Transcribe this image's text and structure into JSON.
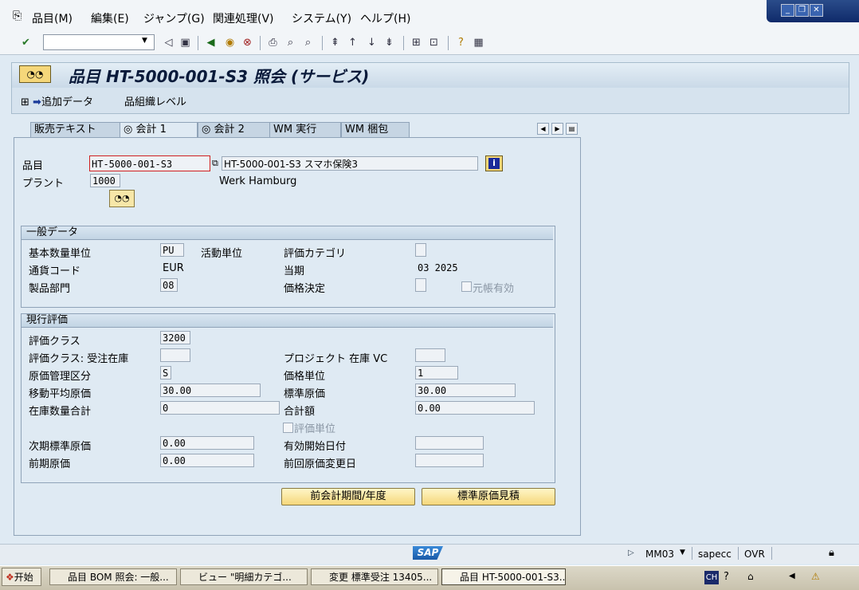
{
  "menu": {
    "items": [
      "品目(M)",
      "編集(E)",
      "ジャンプ(G)",
      "関連処理(V)",
      "システム(Y)",
      "ヘルプ(H)"
    ]
  },
  "title": "品目 HT-5000-001-S3 照会 (サービス)",
  "appbar": {
    "additional_data": "追加データ",
    "org_levels": "組織レベル"
  },
  "tabs": [
    "販売テキスト",
    "会計 1",
    "会計 2",
    "WM 実行",
    "WM 梱包"
  ],
  "header": {
    "material_label": "品目",
    "material_value": "HT-5000-001-S3",
    "material_desc": "HT-5000-001-S3 スマホ保険3",
    "plant_label": "プラント",
    "plant_value": "1000",
    "plant_desc": "Werk Hamburg"
  },
  "general": {
    "title": "一般データ",
    "base_uom_label": "基本数量単位",
    "base_uom_value": "PU",
    "activity_unit_label": "活動単位",
    "valuation_cat_label": "評価カテゴリ",
    "currency_label": "通貨コード",
    "currency_value": "EUR",
    "period_label": "当期",
    "period_value": "03 2025",
    "division_label": "製品部門",
    "division_value": "08",
    "price_det_label": "価格決定",
    "ledger_active_label": "元帳有効"
  },
  "valuation": {
    "title": "現行評価",
    "val_class_label": "評価クラス",
    "val_class_value": "3200",
    "val_class_so_label": "評価クラス: 受注在庫",
    "proj_stock_label": "プロジェクト 在庫 VC",
    "price_control_label": "原価管理区分",
    "price_control_value": "S",
    "price_unit_label": "価格単位",
    "price_unit_value": "1",
    "mov_avg_label": "移動平均原価",
    "mov_avg_value": "30.00",
    "std_price_label": "標準原価",
    "std_price_value": "30.00",
    "total_stock_label": "在庫数量合計",
    "total_stock_value": "0",
    "total_value_label": "合計額",
    "total_value_value": "0.00",
    "valuated_unit_label": "評価単位",
    "future_price_label": "次期標準原価",
    "future_price_value": "0.00",
    "valid_from_label": "有効開始日付",
    "prev_price_label": "前期原価",
    "prev_price_value": "0.00",
    "last_change_label": "前回原価変更日"
  },
  "buttons": {
    "prev_period": "前会計期間/年度",
    "std_cost_est": "標準原価見積"
  },
  "status": {
    "tcode": "MM03",
    "server": "sapecc",
    "mode": "OVR"
  },
  "taskbar": {
    "start": "开始",
    "tasks": [
      "品目 BOM 照会: 一般...",
      "ビュー \"明細カテゴ...",
      "変更 標準受注 13405...",
      "品目 HT-5000-001-S3..."
    ],
    "ime": "CH"
  }
}
